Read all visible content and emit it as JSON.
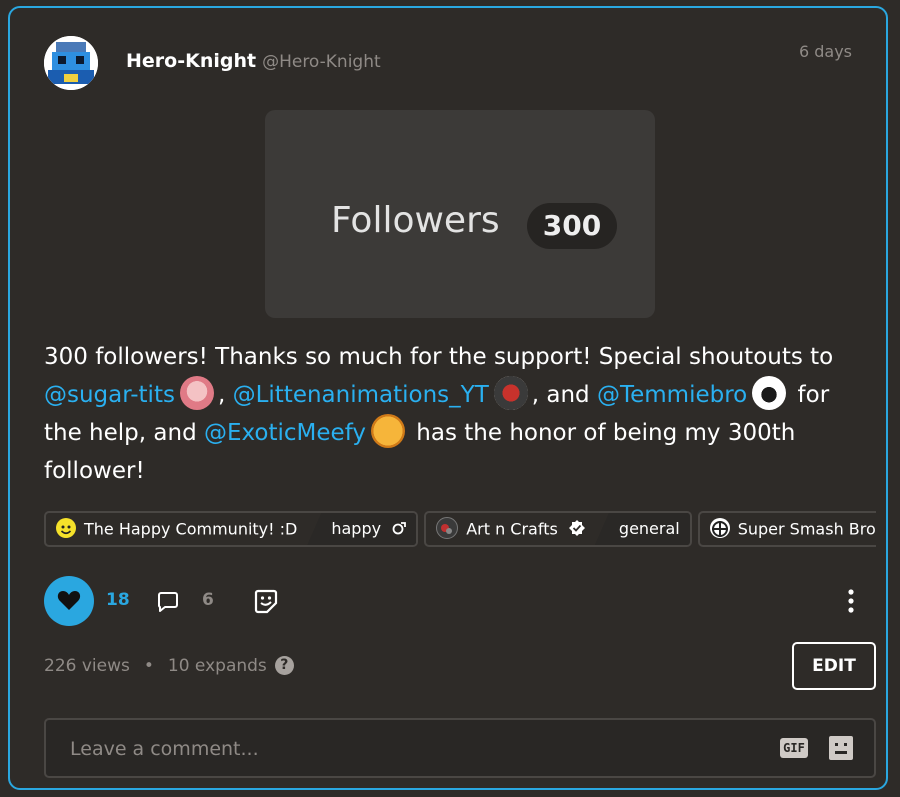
{
  "post": {
    "author_name": "Hero-Knight",
    "author_handle": "@Hero-Knight",
    "time": "6 days",
    "preview": {
      "label": "Followers",
      "badge": "300"
    },
    "body": {
      "t1": "300 followers! Thanks so much for the support! Special shoutouts to ",
      "m1": "@sugar-tits",
      "t2": ", ",
      "m2": "@Littenanimations_YT",
      "t3": ", and ",
      "m3": "@Temmiebro",
      "t4": " for the help, and ",
      "m4": "@ExoticMeefy",
      "t5": " has the honor of being my 300th follower!"
    }
  },
  "communities": [
    {
      "name": "The Happy Community! :D",
      "tag": "happy",
      "icon": "smiley-icon"
    },
    {
      "name": "Art n Crafts",
      "tag": "general",
      "icon": "verified-icon"
    },
    {
      "name": "Super Smash Bros",
      "tag": "",
      "icon": "smash-icon"
    }
  ],
  "actions": {
    "likes": "18",
    "comments": "6"
  },
  "stats": {
    "views": "226 views",
    "separator": "•",
    "expands": "10 expands",
    "help": "?"
  },
  "edit_label": "EDIT",
  "comment": {
    "placeholder": "Leave a comment...",
    "gif_label": "GIF"
  },
  "colors": {
    "accent": "#2aa7e0",
    "background": "#2e2b28",
    "muted": "#8f8a86"
  }
}
